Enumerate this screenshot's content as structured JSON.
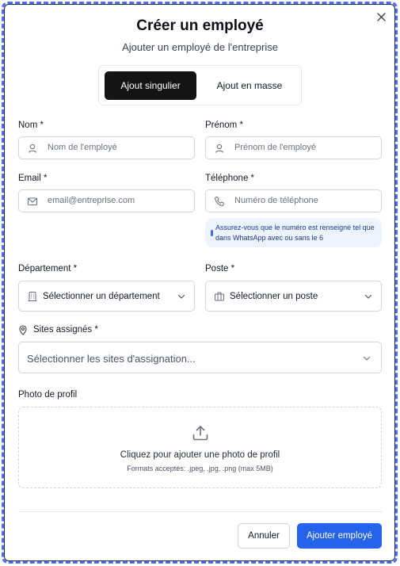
{
  "dialog": {
    "title": "Créer un employé",
    "subtitle": "Ajouter un employé de l'entreprise"
  },
  "tabs": {
    "single": "Ajout singulier",
    "bulk": "Ajout en masse",
    "active": "single"
  },
  "form": {
    "nom": {
      "label": "Nom *",
      "placeholder": "Nom de l'employé",
      "icon": "user-icon"
    },
    "prenom": {
      "label": "Prénom *",
      "placeholder": "Prénom de l'employé",
      "icon": "user-icon"
    },
    "email": {
      "label": "Email *",
      "placeholder": "email@entreprise.com",
      "icon": "mail-icon"
    },
    "telephone": {
      "label": "Téléphone *",
      "placeholder": "Numéro de téléphone",
      "icon": "phone-icon"
    },
    "phone_hint": "Assurez-vous que le numéro est renseigné tel que dans WhatsApp avec ou sans le 6",
    "departement": {
      "label": "Département *",
      "value": "Sélectionner un département",
      "icon": "building-icon"
    },
    "poste": {
      "label": "Poste *",
      "value": "Sélectionner un poste",
      "icon": "briefcase-icon"
    },
    "sites": {
      "label": "Sites assignés *",
      "placeholder": "Sélectionner les sites d'assignation...",
      "icon": "map-pin-icon"
    },
    "photo": {
      "label": "Photo de profil",
      "main_text": "Cliquez pour ajouter une photo de profil",
      "sub_text": "Formats acceptés: .jpeg, .jpg, .png (max 5MB)",
      "icon": "upload-icon"
    }
  },
  "footer": {
    "cancel": "Annuler",
    "submit": "Ajouter employé"
  },
  "colors": {
    "primary": "#2563eb",
    "tab_active_bg": "#141414",
    "hint_bg": "#eef4ff",
    "hint_text": "#1e3a8a"
  }
}
